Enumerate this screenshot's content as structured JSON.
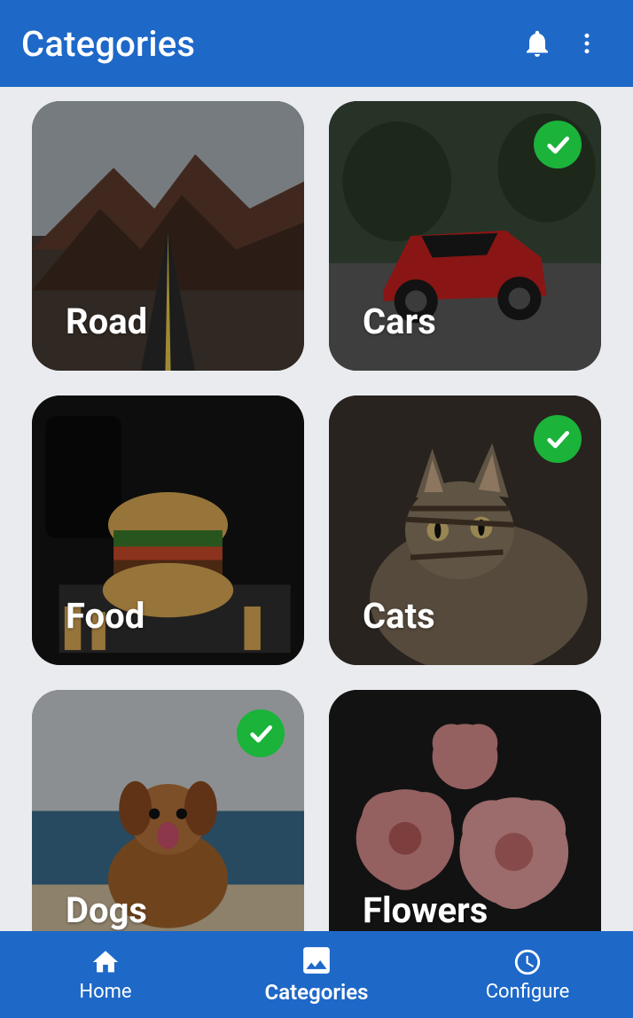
{
  "appbar": {
    "title": "Categories",
    "notification_icon": "bell-icon",
    "menu_icon": "more-vert-icon"
  },
  "categories": [
    {
      "label": "Road",
      "selected": false
    },
    {
      "label": "Cars",
      "selected": true
    },
    {
      "label": "Food",
      "selected": false
    },
    {
      "label": "Cats",
      "selected": true
    },
    {
      "label": "Dogs",
      "selected": true
    },
    {
      "label": "Flowers",
      "selected": false
    }
  ],
  "bottomnav": {
    "items": [
      {
        "label": "Home",
        "icon": "home-icon",
        "active": false
      },
      {
        "label": "Categories",
        "icon": "image-icon",
        "active": true
      },
      {
        "label": "Configure",
        "icon": "clock-icon",
        "active": false
      }
    ]
  },
  "colors": {
    "primary": "#1e68c8",
    "accent_green": "#1bb33a",
    "background": "#e9ebef"
  }
}
